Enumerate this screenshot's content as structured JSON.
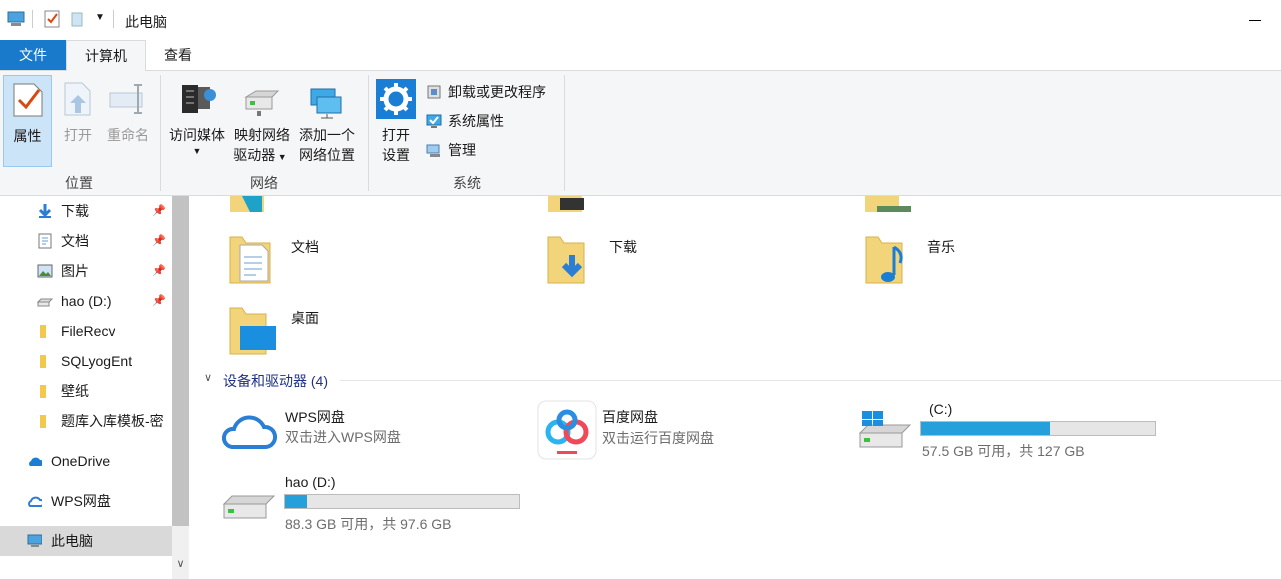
{
  "window": {
    "title": "此电脑"
  },
  "tabs": {
    "file": "文件",
    "computer": "计算机",
    "view": "查看"
  },
  "ribbon": {
    "location": {
      "label": "位置",
      "properties": "属性",
      "open": "打开",
      "rename": "重命名"
    },
    "network": {
      "label": "网络",
      "media_line1": "访问媒体",
      "map_line1": "映射网络",
      "map_line2": "驱动器",
      "add_line1": "添加一个",
      "add_line2": "网络位置"
    },
    "system": {
      "label": "系统",
      "settings_line1": "打开",
      "settings_line2": "设置",
      "uninstall": "卸载或更改程序",
      "sysprops": "系统属性",
      "manage": "管理"
    }
  },
  "sidebar": {
    "items": [
      {
        "label": "下载",
        "icon": "download-arrow-icon"
      },
      {
        "label": "文档",
        "icon": "document-icon"
      },
      {
        "label": "图片",
        "icon": "picture-icon"
      },
      {
        "label": "hao (D:)",
        "icon": "drive-icon"
      },
      {
        "label": "FileRecv",
        "icon": "folder-icon"
      },
      {
        "label": "SQLyogEnt",
        "icon": "folder-icon"
      },
      {
        "label": "壁纸",
        "icon": "folder-icon"
      },
      {
        "label": "题库入库模板-密",
        "icon": "folder-icon"
      },
      {
        "label": "OneDrive",
        "icon": "cloud-icon"
      },
      {
        "label": "WPS网盘",
        "icon": "wps-cloud-icon"
      },
      {
        "label": "此电脑",
        "icon": "computer-icon"
      }
    ]
  },
  "folders": {
    "documents": "文档",
    "downloads": "下载",
    "music": "音乐",
    "desktop": "桌面"
  },
  "devices": {
    "heading": "设备和驱动器 (4)",
    "wps": {
      "name": "WPS网盘",
      "sub": "双击进入WPS网盘"
    },
    "baidu": {
      "name": "百度网盘",
      "sub": "双击运行百度网盘"
    },
    "c": {
      "name": "(C:)",
      "sub": "57.5 GB 可用，共 127 GB",
      "used_fraction": 0.55
    },
    "d": {
      "name": "hao (D:)",
      "sub": "88.3 GB 可用，共 97.6 GB",
      "used_fraction": 0.095
    }
  },
  "colors": {
    "accent": "#1979ca",
    "drive_bar": "#26a0da",
    "section_head": "#1e3287"
  }
}
